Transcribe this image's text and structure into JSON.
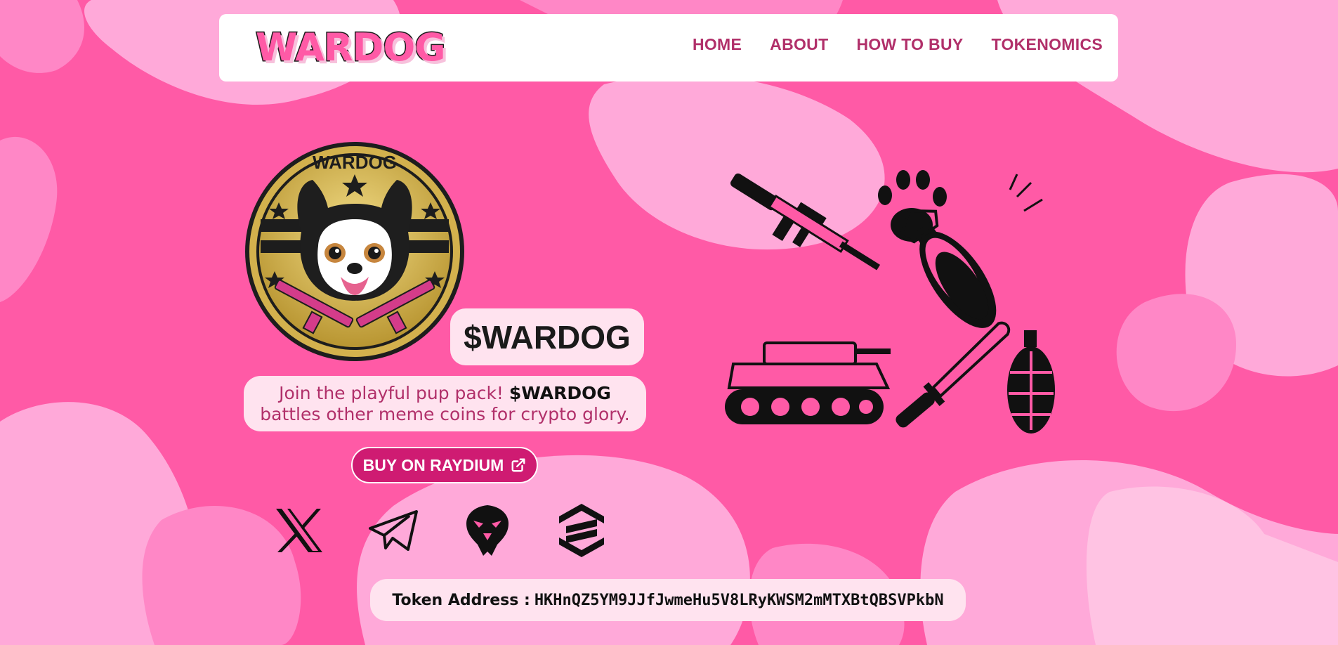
{
  "theme": {
    "background": "#ff5aa6",
    "blob_light": "#ffa9d9",
    "blob_mid": "#ff87c6",
    "panel": "#ffe3ef",
    "accent_text": "#b1306a",
    "button": "#cf1b72"
  },
  "nav": {
    "logo": "WARDOG",
    "links": [
      "HOME",
      "ABOUT",
      "HOW TO BUY",
      "TOKENOMICS"
    ]
  },
  "hero": {
    "coin_text": "WARDOG",
    "ticker": "$WARDOG",
    "tagline_line1": "Join the playful pup pack!",
    "tagline_bold": "$WARDOG",
    "tagline_line2": "battles other meme coins for crypto glory.",
    "buy_button": "BUY ON RAYDIUM",
    "buy_icon": "external-link-icon"
  },
  "socials": [
    {
      "name": "x-icon"
    },
    {
      "name": "telegram-icon"
    },
    {
      "name": "eagle-icon"
    },
    {
      "name": "exchange-logo-icon"
    }
  ],
  "token": {
    "label": "Token Address :",
    "address": "HKHnQZ5YM9JJfJwmeHu5V8LRyKWSM2mMTXBtQBSVPkbN"
  },
  "illustrations": [
    "rifle-icon",
    "paw-icon",
    "bomb-icon",
    "tank-icon",
    "knife-icon",
    "grenade-icon"
  ]
}
